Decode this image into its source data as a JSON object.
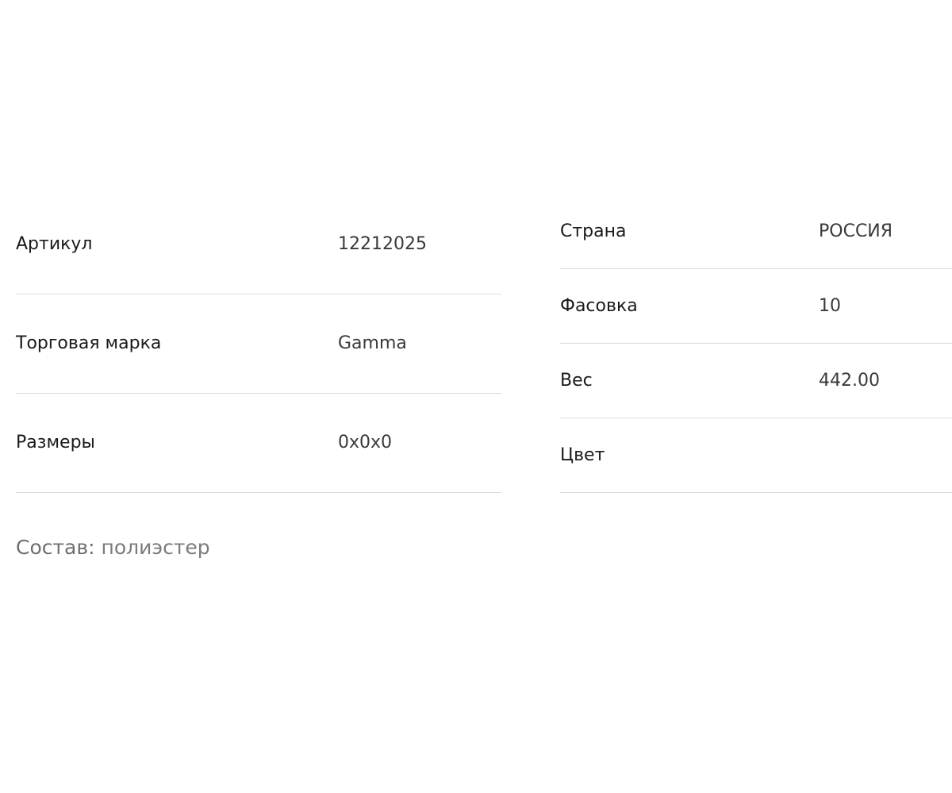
{
  "specs_left": [
    {
      "label": "Артикул",
      "value": "12212025"
    },
    {
      "label": "Торговая марка",
      "value": "Gamma"
    },
    {
      "label": "Размеры",
      "value": "0x0x0"
    }
  ],
  "specs_right": [
    {
      "label": "Страна",
      "value": "РОССИЯ"
    },
    {
      "label": "Фасовка",
      "value": "10"
    },
    {
      "label": "Вес",
      "value": "442.00"
    },
    {
      "label": "Цвет",
      "value": ""
    }
  ],
  "composition": {
    "label": "Состав:",
    "value": "полиэстер"
  }
}
